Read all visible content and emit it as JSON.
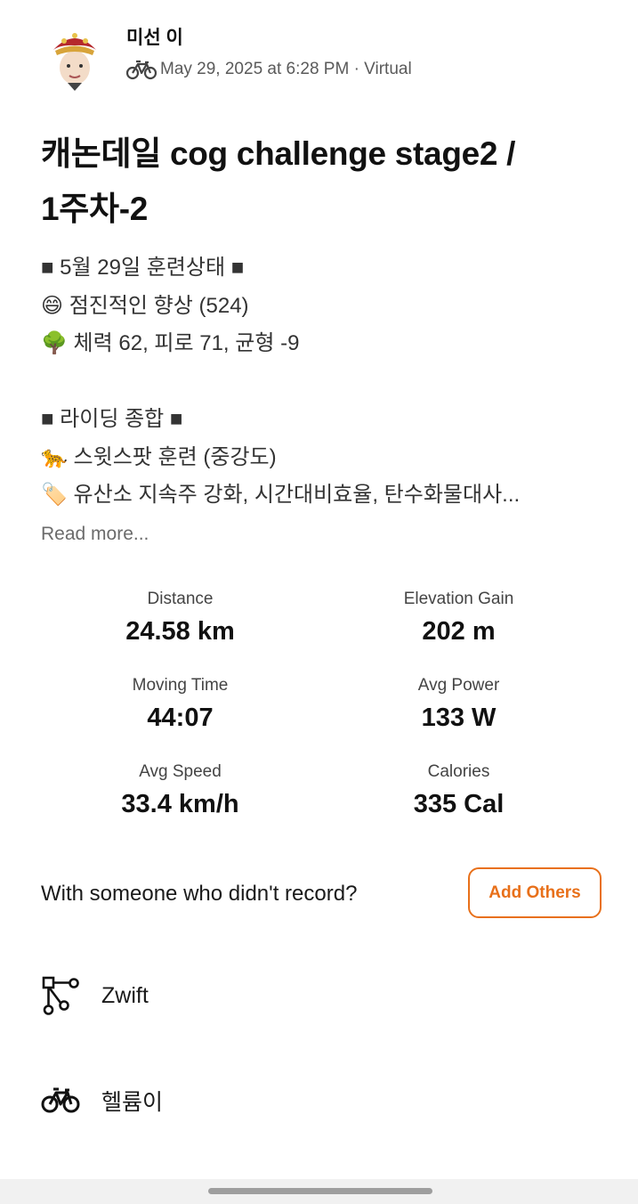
{
  "header": {
    "athlete_name": "미선 이",
    "meta": "May 29, 2025 at 6:28 PM · Virtual",
    "activity_type_icon": "bike-icon",
    "avatar_icon": "avatar"
  },
  "activity": {
    "title_line1": "캐논데일 cog challenge stage2 /",
    "title_line2": "1주차-2",
    "description": [
      "■ 5월 29일 훈련상태 ■",
      "😄 점진적인 향상 (524)",
      "🌳 체력 62, 피로 71, 균형 -9",
      "",
      "■ 라이딩 종합 ■",
      "🐆 스윗스팟 훈련 (중강도)",
      "🏷️ 유산소 지속주 강화, 시간대비효율, 탄수화물대사..."
    ],
    "read_more": "Read more..."
  },
  "stats": [
    {
      "label": "Distance",
      "value": "24.58 km"
    },
    {
      "label": "Elevation Gain",
      "value": "202 m"
    },
    {
      "label": "Moving Time",
      "value": "44:07"
    },
    {
      "label": "Avg Power",
      "value": "133 W"
    },
    {
      "label": "Avg Speed",
      "value": "33.4 km/h"
    },
    {
      "label": "Calories",
      "value": "335 Cal"
    }
  ],
  "add_others": {
    "prompt": "With someone who didn't record?",
    "button_label": "Add Others",
    "accent_color": "#e8701a"
  },
  "links": [
    {
      "icon": "route-icon",
      "label": "Zwift"
    },
    {
      "icon": "bike-icon",
      "label": "헬륨이"
    }
  ]
}
